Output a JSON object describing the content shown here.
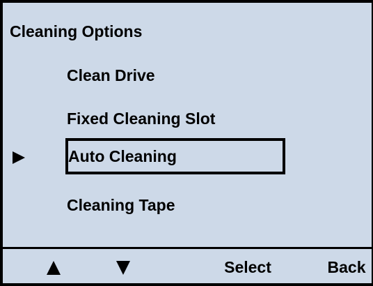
{
  "screen": {
    "title": "Cleaning Options",
    "background_color": "#cdd9e8"
  },
  "menu": {
    "items": [
      {
        "label": "Clean Drive"
      },
      {
        "label": "Fixed Cleaning Slot"
      },
      {
        "label": "Auto Cleaning"
      },
      {
        "label": "Cleaning Tape"
      }
    ],
    "selected_label": "Auto Cleaning",
    "pointer_icon": "triangle-right-icon"
  },
  "softkeys": {
    "up_icon": "triangle-up-icon",
    "down_icon": "triangle-down-icon",
    "select_label": "Select",
    "back_label": "Back"
  }
}
